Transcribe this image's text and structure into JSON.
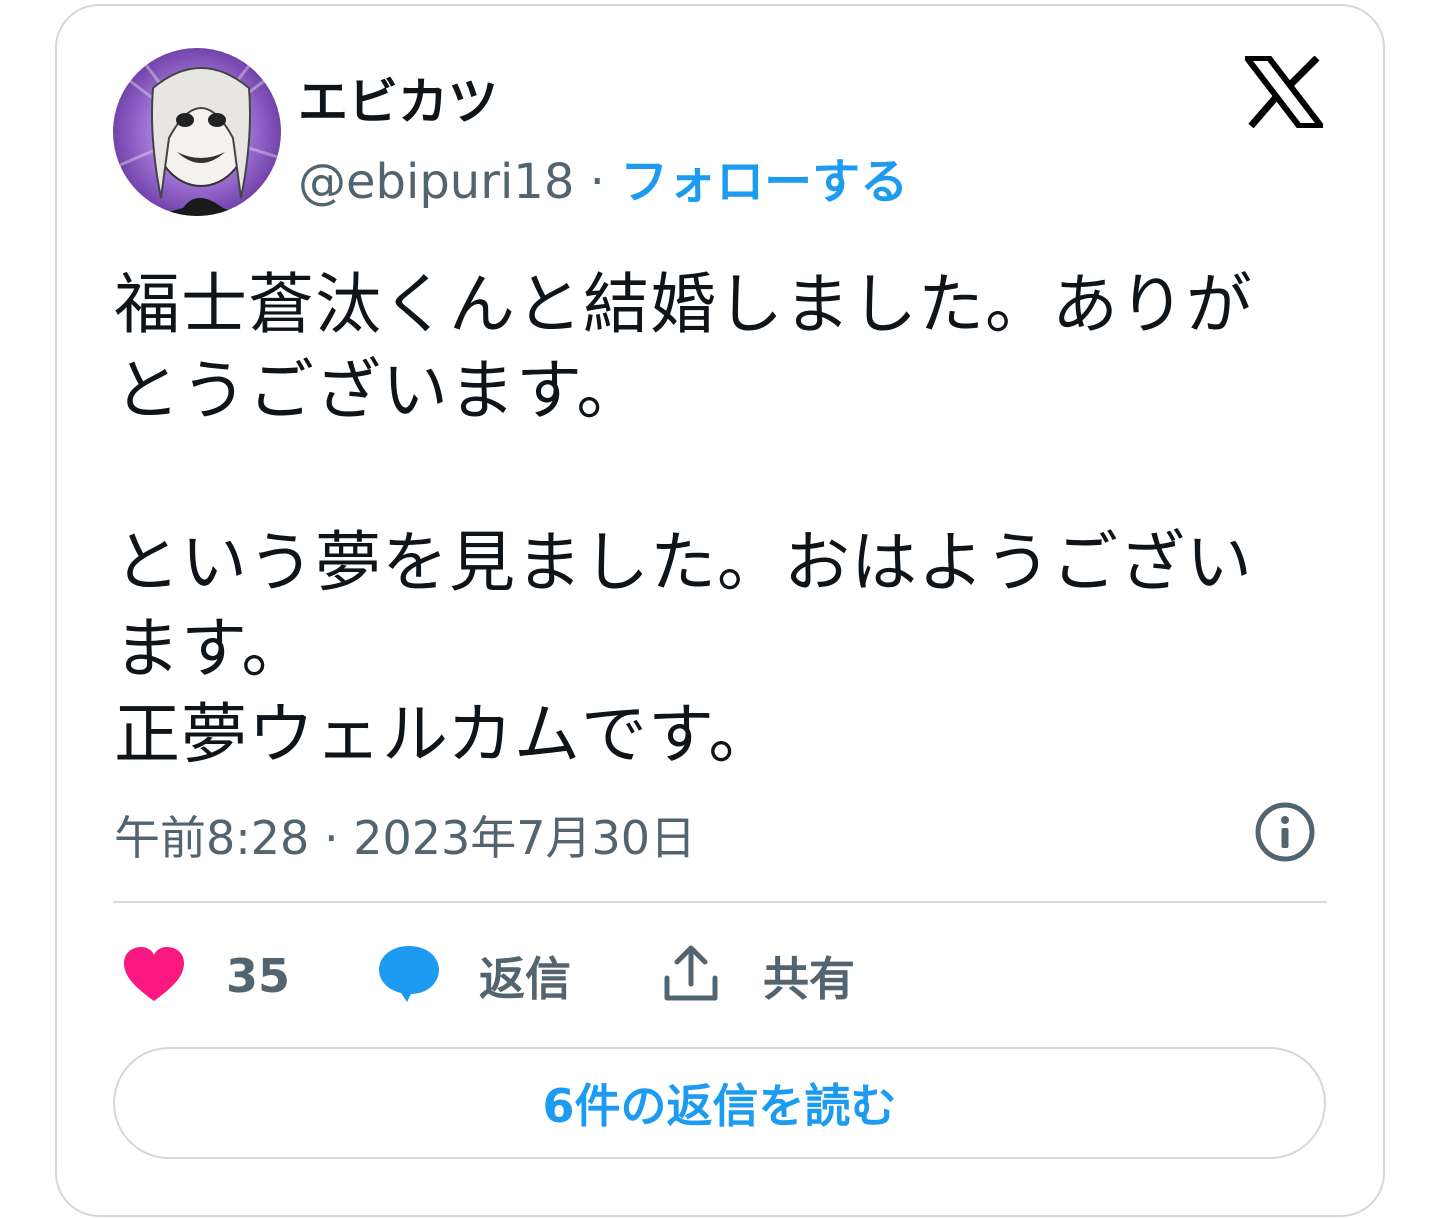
{
  "author": {
    "display_name": "エビカツ",
    "handle": "@ebipuri18",
    "separator": "·",
    "follow_label": "フォローする"
  },
  "tweet": {
    "lines": [
      "福士蒼汰くんと結婚しました。ありが",
      "とうございます。",
      "",
      "という夢を見ました。おはようござい",
      "ます。",
      "正夢ウェルカムです。"
    ],
    "time": "午前8:28",
    "date_separator": "·",
    "date": "2023年7月30日"
  },
  "actions": {
    "like_count": "35",
    "reply_label": "返信",
    "share_label": "共有"
  },
  "read_replies_label": "6件の返信を読む",
  "colors": {
    "accent": "#1d9bf0",
    "like": "#f91880",
    "text": "#0f1419",
    "secondary": "#536471",
    "border": "#cfd9de"
  },
  "icons": [
    "avatar",
    "x-logo-icon",
    "info-icon",
    "heart-icon",
    "comment-icon",
    "share-icon"
  ]
}
